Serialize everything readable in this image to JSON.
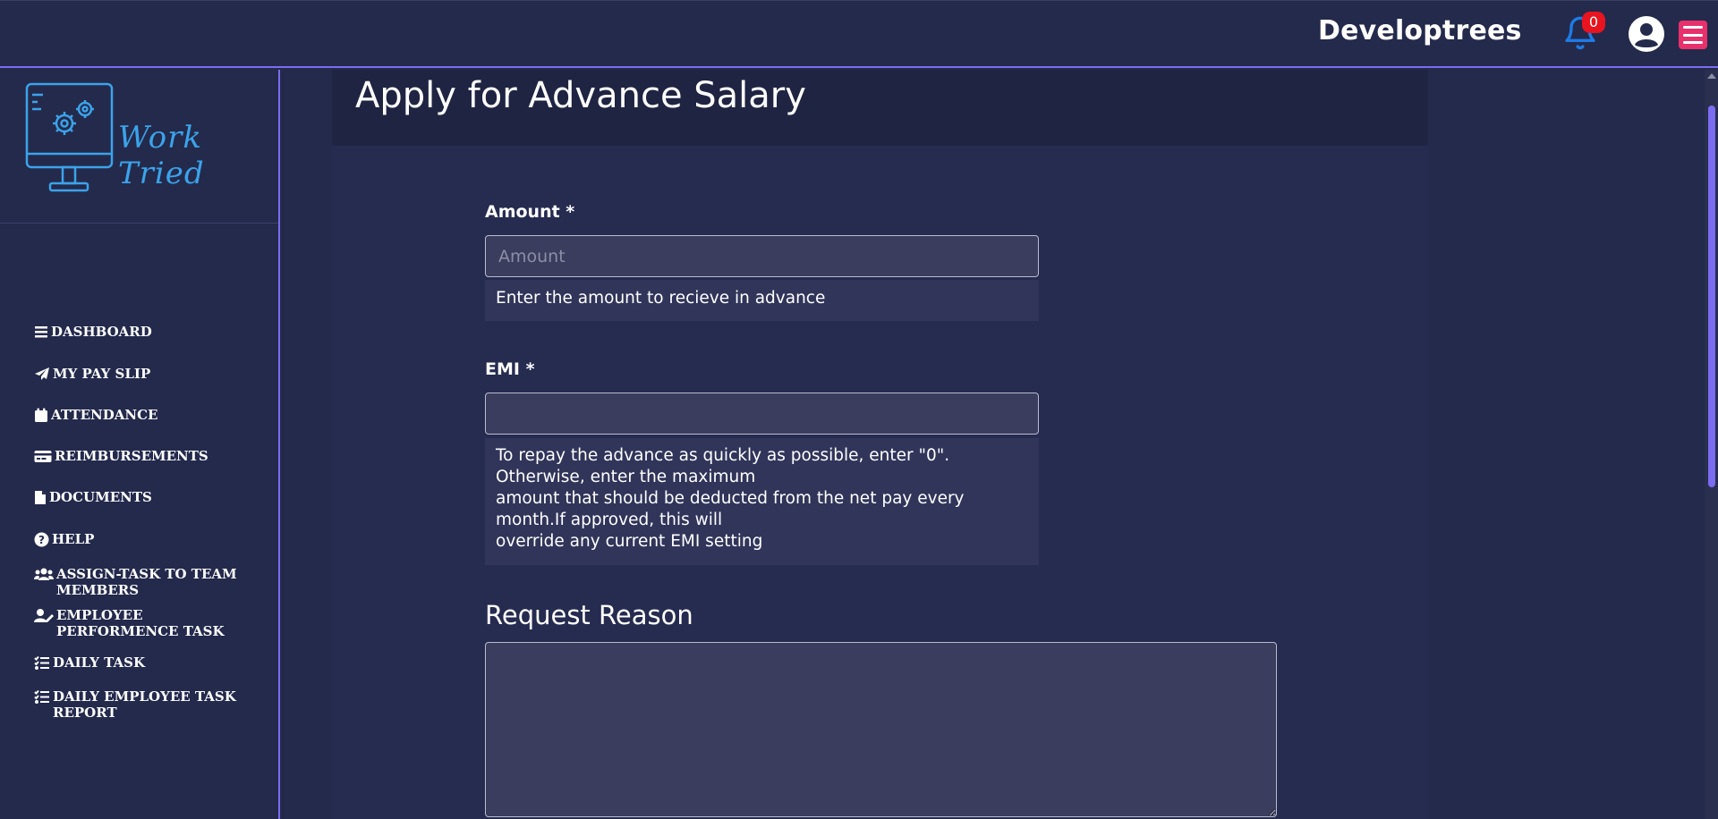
{
  "header": {
    "company_name": "Developtrees",
    "notification_count": "0"
  },
  "sidebar": {
    "logo_text": "Work Tried",
    "items": [
      {
        "label": "DASHBOARD",
        "icon": "bars-icon"
      },
      {
        "label": "MY PAY SLIP",
        "icon": "paper-plane-icon"
      },
      {
        "label": "ATTENDANCE",
        "icon": "calendar-icon"
      },
      {
        "label": "REIMBURSEMENTS",
        "icon": "credit-card-icon"
      },
      {
        "label": "DOCUMENTS",
        "icon": "file-icon"
      },
      {
        "label": "HELP",
        "icon": "question-circle-icon"
      },
      {
        "label": "ASSIGN-TASK TO TEAM MEMBERS",
        "icon": "users-icon"
      },
      {
        "label": "EMPLOYEE PERFORMENCE TASK",
        "icon": "user-edit-icon"
      },
      {
        "label": "DAILY TASK",
        "icon": "list-check-icon"
      },
      {
        "label": "DAILY EMPLOYEE TASK REPORT",
        "icon": "list-check-icon"
      }
    ]
  },
  "main": {
    "title": "Apply for Advance Salary",
    "amount": {
      "label": "Amount *",
      "placeholder": "Amount",
      "value": "",
      "help": "Enter the amount to recieve in advance"
    },
    "emi": {
      "label": "EMI *",
      "value": "",
      "help_lines": [
        "To repay the advance as quickly as possible, enter \"0\".",
        "Otherwise, enter the maximum",
        "amount that should be deducted from the net pay every",
        "month.If approved, this will",
        "override any current EMI setting"
      ]
    },
    "reason": {
      "title": "Request Reason",
      "value": ""
    }
  },
  "colors": {
    "background": "#242a4c",
    "accent": "#7b6cf0",
    "logo": "#3ba3ea",
    "bell": "#1e7be6",
    "badge": "#e8141f",
    "menu_button": "#e8306c"
  }
}
